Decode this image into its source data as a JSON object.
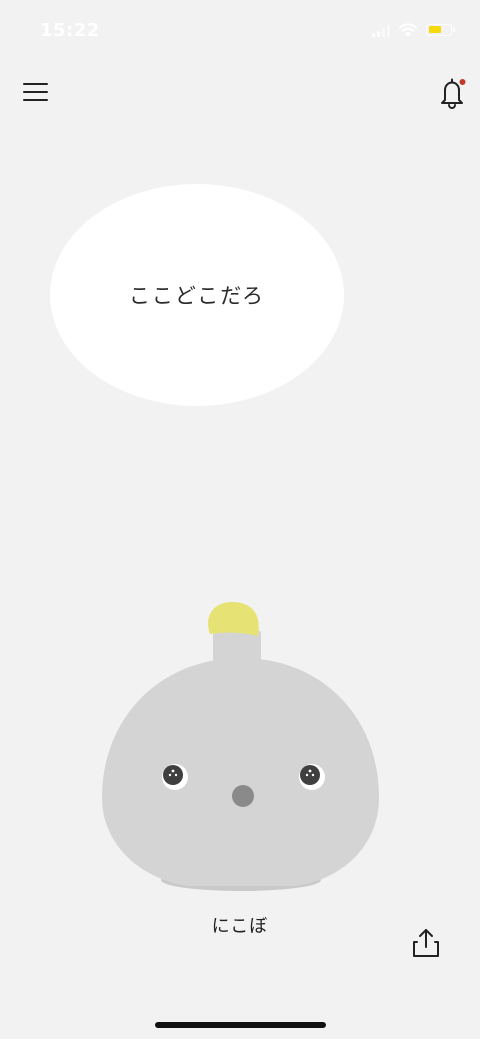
{
  "status_bar": {
    "time": "15:22",
    "icons": [
      "cellular-signal-icon",
      "wifi-icon",
      "battery-icon"
    ],
    "battery_color": "#f5d90a"
  },
  "header": {
    "menu_icon": "hamburger-menu-icon",
    "notification_icon": "bell-icon",
    "notification_badge_color": "#c0392b"
  },
  "main": {
    "speech_bubble_text": "ここどこだろ",
    "robot_name": "にこぼ",
    "robot_colors": {
      "body": "#d4d4d4",
      "tuft": "#e6e274",
      "nose": "#8a8a8a"
    }
  },
  "footer": {
    "share_icon": "share-icon"
  },
  "colors": {
    "background": "#f2f2f2",
    "bubble": "#ffffff"
  }
}
